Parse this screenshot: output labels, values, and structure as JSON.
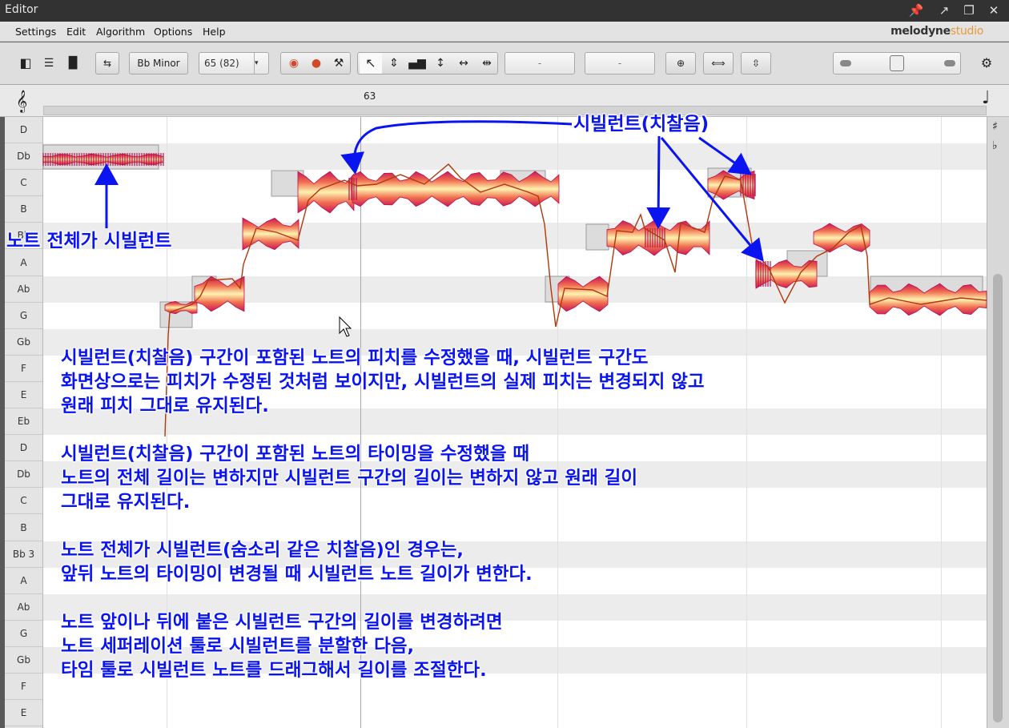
{
  "window": {
    "title": "Editor"
  },
  "menu": {
    "items": [
      "Settings",
      "Edit",
      "Algorithm",
      "Options",
      "Help"
    ],
    "brand_main": "melodyne",
    "brand_sub": "studio"
  },
  "toolbar": {
    "key": "Bb Minor",
    "bar_value": "65 (82)",
    "field_a": "-",
    "field_b": "-"
  },
  "ruler": {
    "bar_number": "63"
  },
  "pitch_lanes": [
    "D",
    "Db",
    "C",
    "B",
    "Bb",
    "A",
    "Ab",
    "G",
    "Gb",
    "F",
    "E",
    "Eb",
    "D",
    "Db",
    "C",
    "B",
    "Bb 3",
    "A",
    "Ab",
    "G",
    "Gb",
    "F",
    "E"
  ],
  "annotations": {
    "sibilant_label": "시빌런트(치찰음)",
    "whole_note_label": "노트 전체가 시빌런트",
    "para1": [
      "시빌런트(치찰음) 구간이 포함된 노트의 피치를 수정했을 때, 시빌런트 구간도",
      "화면상으로는 피치가 수정된 것처럼 보이지만, 시빌런트의 실제 피치는 변경되지 않고",
      "원래 피치 그대로 유지된다."
    ],
    "para2": [
      "시빌런트(치찰음) 구간이 포함된 노트의 타이밍을 수정했을 때",
      "노트의 전체 길이는 변하지만 시빌런트 구간의 길이는 변하지 않고 원래 길이",
      "그대로 유지된다."
    ],
    "para3": [
      "노트 전체가 시빌런트(숨소리 같은 치찰음)인 경우는,",
      "앞뒤 노트의 타이밍이 변경될 때 시빌런트 노트 길이가 변한다."
    ],
    "para4": [
      "노트 앞이나 뒤에 붙은 시빌런트 구간의 길이를 변경하려면",
      "노트 세퍼레이션 툴로 시빌런트를 분할한 다음,",
      "타임 툴로 시빌런트 노트를 드래그해서 길이를 조절한다."
    ]
  },
  "colors": {
    "annotation": "#0a14f0",
    "blob_edge": "#c8185a",
    "blob_center": "#fff2b0"
  }
}
